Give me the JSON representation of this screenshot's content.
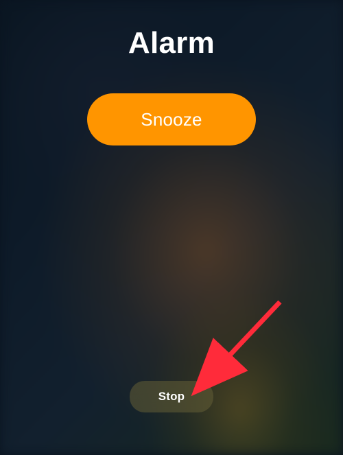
{
  "alarm": {
    "title": "Alarm",
    "snooze_label": "Snooze",
    "stop_label": "Stop"
  }
}
